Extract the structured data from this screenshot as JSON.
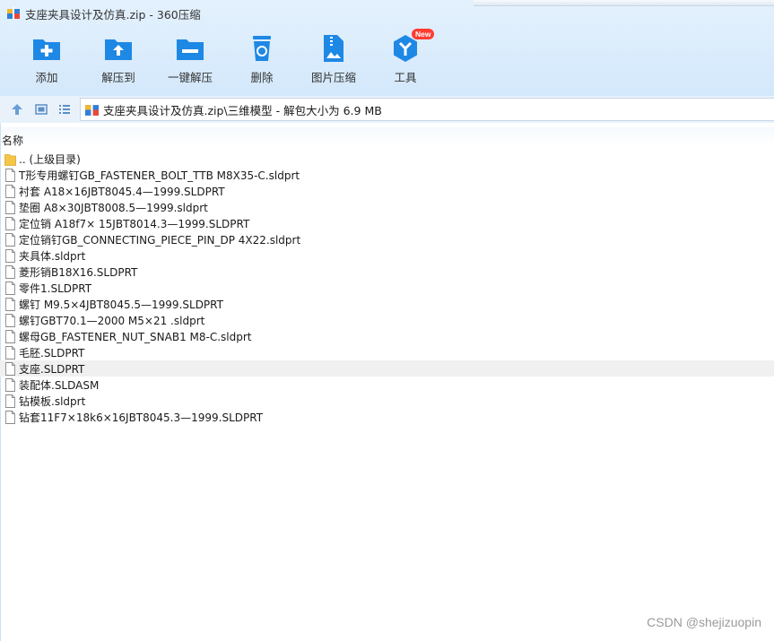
{
  "window": {
    "title": "支座夹具设计及仿真.zip - 360压缩"
  },
  "toolbar": {
    "items": [
      {
        "label": "添加",
        "icon": "add-icon"
      },
      {
        "label": "解压到",
        "icon": "extract-to-icon"
      },
      {
        "label": "一键解压",
        "icon": "one-click-extract-icon"
      },
      {
        "label": "删除",
        "icon": "delete-icon"
      },
      {
        "label": "图片压缩",
        "icon": "image-compress-icon"
      },
      {
        "label": "工具",
        "icon": "tools-icon",
        "badge": "New"
      }
    ]
  },
  "nav": {
    "address": "支座夹具设计及仿真.zip\\三维模型 - 解包大小为 6.9 MB"
  },
  "list": {
    "column_header": "名称",
    "parent": ".. (上级目录)",
    "files": [
      "T形专用螺钉GB_FASTENER_BOLT_TTB M8X35-C.sldprt",
      "衬套 A18×16JBT8045.4—1999.SLDPRT",
      "垫圈 A8×30JBT8008.5—1999.sldprt",
      "定位销 A18f7× 15JBT8014.3—1999.SLDPRT",
      "定位销钉GB_CONNECTING_PIECE_PIN_DP 4X22.sldprt",
      "夹具体.sldprt",
      "菱形销B18X16.SLDPRT",
      "零件1.SLDPRT",
      "螺钉 M9.5×4JBT8045.5—1999.SLDPRT",
      "螺钉GBT70.1—2000 M5×21 .sldprt",
      "螺母GB_FASTENER_NUT_SNAB1 M8-C.sldprt",
      "毛胚.SLDPRT",
      "支座.SLDPRT",
      "装配体.SLDASM",
      "钻模板.sldprt",
      "钻套11F7×18k6×16JBT8045.3—1999.SLDPRT"
    ],
    "selected_file": "支座.SLDPRT"
  },
  "watermark": "CSDN @shejizuopin",
  "colors": {
    "accent": "#1e88e5",
    "toolbar_bg": "#dbeafb",
    "badge": "#ff3b30",
    "folder": "#f5c54a"
  }
}
